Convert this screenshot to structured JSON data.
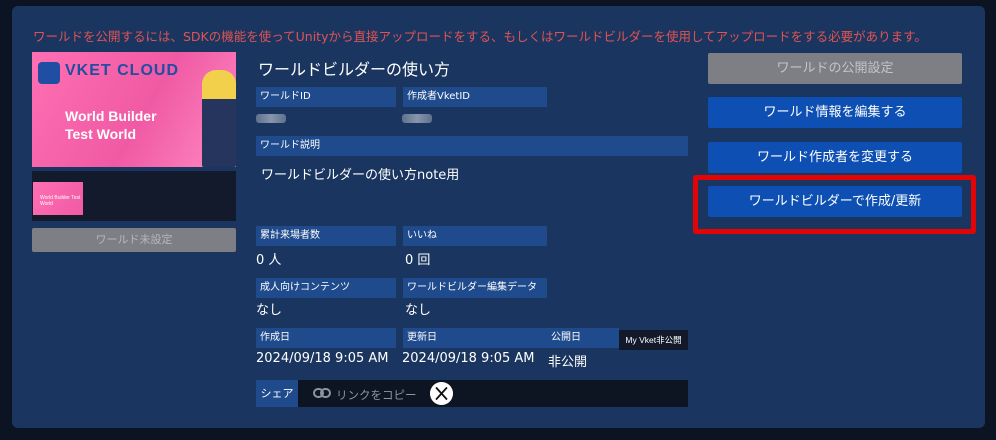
{
  "warning": "ワールドを公開するには、SDKの機能を使ってUnityから直接アップロードをする、もしくはワールドビルダーを使用してアップロードをする必要があります。",
  "thumbnail": {
    "logo_text": "VKET CLOUD",
    "title_line1": "World Builder",
    "title_line2": "Test World",
    "small_text": "World Builder Test World"
  },
  "left_button": "ワールド未設定",
  "world_title": "ワールドビルダーの使い方",
  "fields": {
    "world_id_label": "ワールドID",
    "creator_id_label": "作成者VketID",
    "description_label": "ワールド説明",
    "description_value": "ワールドビルダーの使い方note用",
    "visitors_label": "累計来場者数",
    "visitors_value": "0 人",
    "likes_label": "いいね",
    "likes_value": "0 回",
    "adult_label": "成人向けコンテンツ",
    "adult_value": "なし",
    "builder_data_label": "ワールドビルダー編集データ",
    "builder_data_value": "なし",
    "created_label": "作成日",
    "created_value": "2024/09/18 9:05 AM",
    "updated_label": "更新日",
    "updated_value": "2024/09/18 9:05 AM",
    "public_label": "公開日",
    "public_value": "非公開",
    "myvket_badge": "My Vket非公開"
  },
  "share": {
    "label": "シェア",
    "copy_link": "リンクをコピー",
    "x_icon": "x-logo-icon",
    "link_icon": "link-icon"
  },
  "buttons": {
    "publish_settings": "ワールドの公開設定",
    "edit_info": "ワールド情報を編集する",
    "change_creator": "ワールド作成者を変更する",
    "builder_update": "ワールドビルダーで作成/更新"
  },
  "colors": {
    "panel": "#1a3660",
    "label_bg": "#1f4a8c",
    "primary_button": "#0d4fb2",
    "disabled_button": "#7d7f85",
    "warning_text": "#e05353",
    "highlight": "#e30505"
  }
}
